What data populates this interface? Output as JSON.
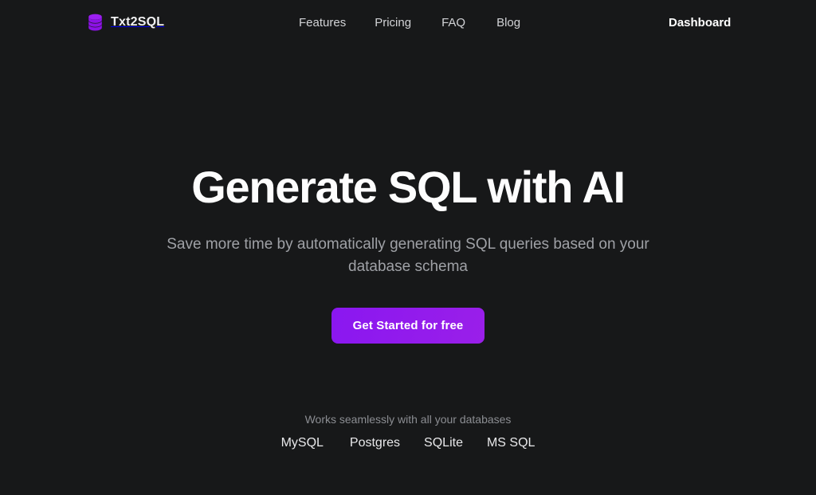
{
  "theme": {
    "background": "#171819",
    "accent": "#8a17f0",
    "accent_end": "#9a1fe9",
    "text_primary": "#fdfdfd",
    "text_muted": "#9fa1a6"
  },
  "header": {
    "brand": {
      "name": "Txt2SQL",
      "icon": "database-icon",
      "icon_color": "#9b1ff0"
    },
    "nav": [
      {
        "label": "Features"
      },
      {
        "label": "Pricing"
      },
      {
        "label": "FAQ"
      },
      {
        "label": "Blog"
      }
    ],
    "dashboard_label": "Dashboard"
  },
  "hero": {
    "title": "Generate SQL with AI",
    "subtitle_line1": "Save more time by automatically generating SQL queries",
    "subtitle_line2": "based on your database schema",
    "cta_label": "Get Started for free"
  },
  "databases": {
    "caption": "Works seamlessly with all your databases",
    "items": [
      {
        "label": "MySQL"
      },
      {
        "label": "Postgres"
      },
      {
        "label": "SQLite"
      },
      {
        "label": "MS SQL"
      }
    ]
  }
}
